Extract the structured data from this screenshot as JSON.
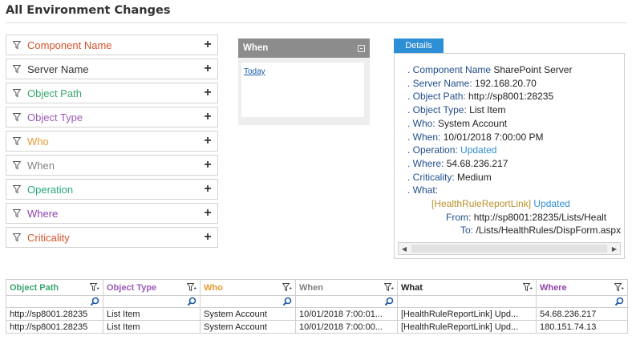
{
  "page": {
    "title": "All Environment Changes"
  },
  "filters": [
    {
      "label": "Component Name",
      "color": "#d4532a"
    },
    {
      "label": "Server Name",
      "color": "#333333"
    },
    {
      "label": "Object Path",
      "color": "#3aa66e"
    },
    {
      "label": "Object Type",
      "color": "#9b59b6"
    },
    {
      "label": "Who",
      "color": "#e69a2e"
    },
    {
      "label": "When",
      "color": "#808080"
    },
    {
      "label": "Operation",
      "color": "#2aa879"
    },
    {
      "label": "Where",
      "color": "#8e44ad"
    },
    {
      "label": "Criticality",
      "color": "#d4532a"
    }
  ],
  "when_panel": {
    "title": "When",
    "link": "Today"
  },
  "details": {
    "tab": "Details",
    "lines": [
      {
        "k": ". Component Name",
        "v": "SharePoint Server"
      },
      {
        "k": ". Server Name:",
        "v": "192.168.20.70"
      },
      {
        "k": ". Object Path:",
        "v": "http://sp8001:28235"
      },
      {
        "k": ". Object Type:",
        "v": "List Item"
      },
      {
        "k": ". Who:",
        "v": "System Account"
      },
      {
        "k": ". When:",
        "v": "10/01/2018 7:00:00 PM"
      },
      {
        "k": ". Operation:",
        "v": "Updated"
      },
      {
        "k": ". Where:",
        "v": "54.68.236.217"
      },
      {
        "k": ". Criticality:",
        "v": "Medium"
      },
      {
        "k": ". What:",
        "v": ""
      }
    ],
    "what_link": "[HealthRuleReportLink]",
    "what_op": "Updated",
    "from_label": "From:",
    "from_value": "http://sp8001:28235/Lists/Healt",
    "to_label": "To:",
    "to_value": "/Lists/HealthRules/DispForm.aspx"
  },
  "grid": {
    "columns": [
      {
        "label": "Object Path",
        "color": "#3aa66e"
      },
      {
        "label": "Object Type",
        "color": "#9b59b6"
      },
      {
        "label": "Who",
        "color": "#e69a2e"
      },
      {
        "label": "When",
        "color": "#808080"
      },
      {
        "label": "What",
        "color": "#222222"
      },
      {
        "label": "Where",
        "color": "#8e44ad"
      }
    ],
    "rows": [
      [
        "http://sp8001.28235",
        "List Item",
        "System Account",
        "10/01/2018 7:00:01...",
        "[HealthRuleReportLink] Upd...",
        "54.68.236.217"
      ],
      [
        "http://sp8001.28235",
        "List Item",
        "System Account",
        "10/01/2018 7:00:00...",
        "[HealthRuleReportLink] Upd...",
        "180.151.74.13"
      ]
    ]
  }
}
